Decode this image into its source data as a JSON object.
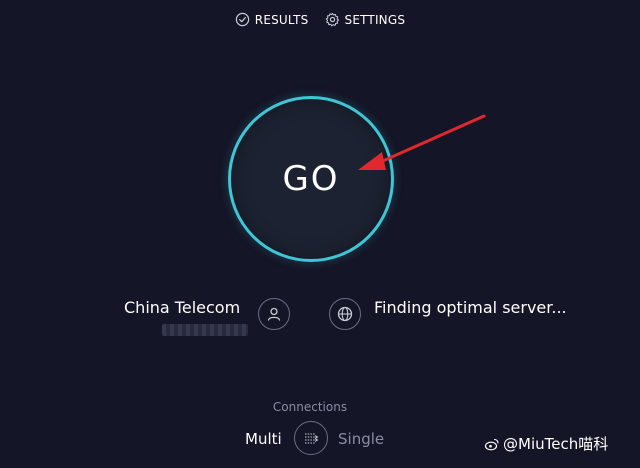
{
  "nav": {
    "results_label": "RESULTS",
    "settings_label": "SETTINGS"
  },
  "go_button": {
    "label": "GO"
  },
  "isp": {
    "name": "China Telecom"
  },
  "server": {
    "status": "Finding optimal server..."
  },
  "connections": {
    "title": "Connections",
    "multi_label": "Multi",
    "single_label": "Single"
  },
  "watermark": {
    "text": "@MiuTech喵科"
  },
  "colors": {
    "background": "#141526",
    "ring": "#3ec6d6",
    "arrow": "#e0282e",
    "muted_text": "#8a8ca3"
  },
  "icons": [
    "check-circle-icon",
    "gear-icon",
    "user-icon",
    "globe-icon",
    "connections-icon",
    "weibo-icon"
  ]
}
